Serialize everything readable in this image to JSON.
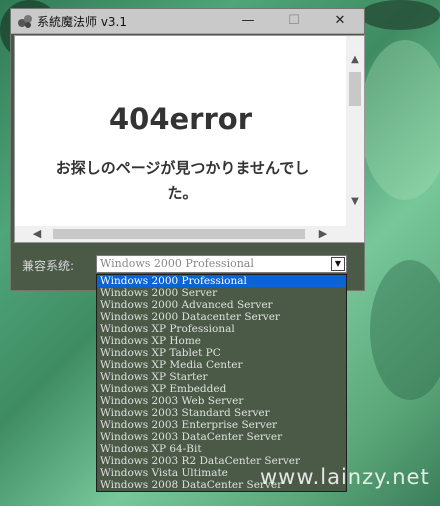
{
  "window": {
    "title": "系統魔法师 v3.1",
    "min_glyph": "—",
    "max_glyph": "☐",
    "close_glyph": "✕"
  },
  "browser": {
    "error_title": "404error",
    "error_message": "お探しのページが見つかりませんでした。"
  },
  "compat": {
    "label": "兼容系统:",
    "selected": "Windows 2000 Professional",
    "options": [
      "Windows 2000 Professional",
      "Windows 2000 Server",
      "Windows 2000 Advanced Server",
      "Windows 2000 Datacenter Server",
      "Windows XP Professional",
      "Windows XP Home",
      "Windows XP Tablet PC",
      "Windows XP Media Center",
      "Windows XP Starter",
      "Windows XP Embedded",
      "Windows 2003 Web Server",
      "Windows 2003 Standard Server",
      "Windows 2003 Enterprise Server",
      "Windows 2003 DataCenter Server",
      "Windows XP 64-Bit",
      "Windows 2003 R2 DataCenter Server",
      "Windows Vista Ultimate",
      "Windows 2008 DataCenter Server"
    ],
    "selected_index": 0
  },
  "watermark": "www.lainzy.net",
  "colors": {
    "accent_selected": "#0a64d6",
    "window_bg": "#4a5a47"
  }
}
